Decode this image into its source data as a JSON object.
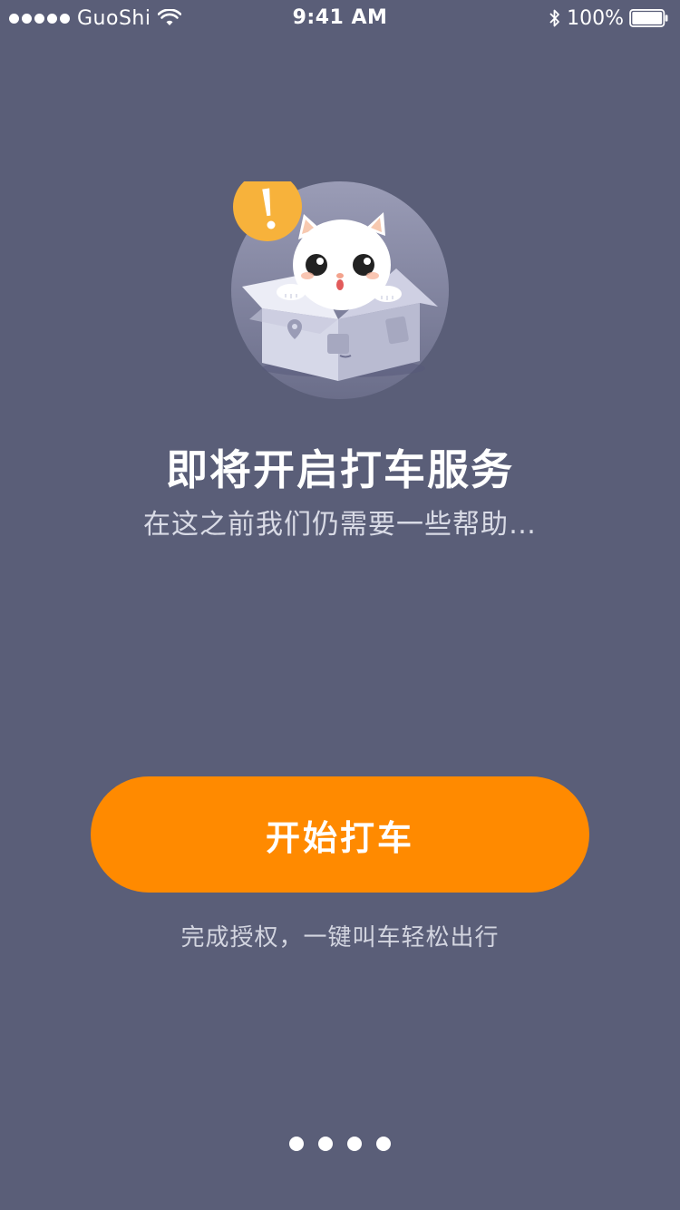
{
  "status_bar": {
    "carrier": "GuoShi",
    "time": "9:41 AM",
    "battery": "100%"
  },
  "hero": {
    "illustration": "cat-in-box",
    "badge_icon": "warning-icon",
    "badge_color": "#f7b23b"
  },
  "content": {
    "title": "即将开启打车服务",
    "subtitle": "在这之前我们仍需要一些帮助…"
  },
  "cta": {
    "label": "开始打车",
    "color": "#ff8a00"
  },
  "caption": "完成授权，一键叫车轻松出行",
  "pager": {
    "count": 4
  },
  "colors": {
    "background": "#5a5e78",
    "accent": "#ff8a00"
  }
}
